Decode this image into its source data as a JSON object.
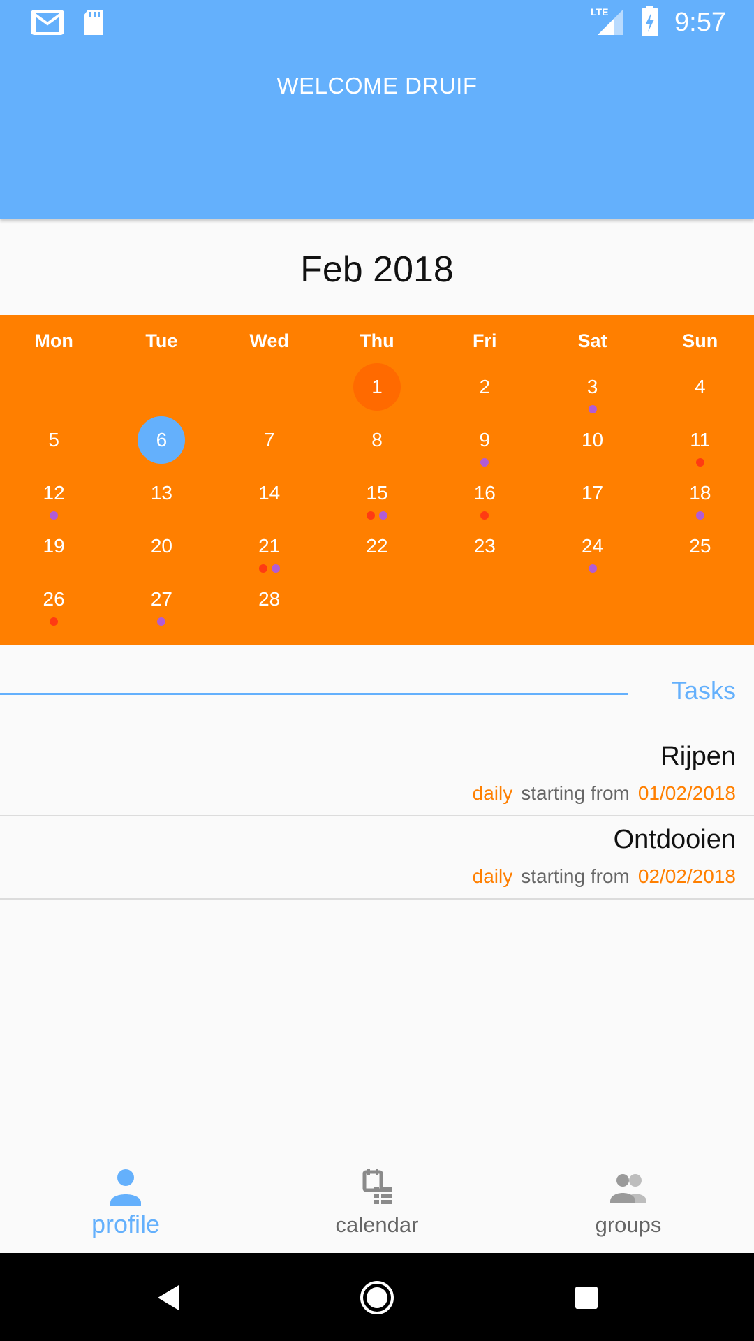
{
  "status_bar": {
    "time": "9:57",
    "network": "LTE"
  },
  "header": {
    "title": "WELCOME DRUIF"
  },
  "calendar": {
    "month_title": "Feb 2018",
    "weekdays": [
      "Mon",
      "Tue",
      "Wed",
      "Thu",
      "Fri",
      "Sat",
      "Sun"
    ],
    "first_weekday_index": 3,
    "days_in_month": 28,
    "start_day": 1,
    "today": 6,
    "event_dots": {
      "3": [
        "purple"
      ],
      "9": [
        "purple"
      ],
      "11": [
        "red"
      ],
      "12": [
        "purple"
      ],
      "15": [
        "red",
        "purple"
      ],
      "16": [
        "red"
      ],
      "18": [
        "purple"
      ],
      "21": [
        "red",
        "purple"
      ],
      "24": [
        "purple"
      ],
      "26": [
        "red"
      ],
      "27": [
        "purple"
      ]
    },
    "colors": {
      "background": "#ff7f00",
      "start_circle": "#ff6a00",
      "today_circle": "#64b0fc",
      "dot_red": "#ff3b12",
      "dot_purple": "#b15cd6"
    }
  },
  "tasks": {
    "label": "Tasks",
    "items": [
      {
        "title": "Rijpen",
        "frequency": "daily",
        "from_text": "starting from",
        "date": "01/02/2018"
      },
      {
        "title": "Ontdooien",
        "frequency": "daily",
        "from_text": "starting from",
        "date": "02/02/2018"
      }
    ]
  },
  "bottom_nav": {
    "items": [
      {
        "label": "profile",
        "icon": "person-icon",
        "active": true
      },
      {
        "label": "calendar",
        "icon": "calendar-list-icon",
        "active": false
      },
      {
        "label": "groups",
        "icon": "group-icon",
        "active": false
      }
    ]
  },
  "theme": {
    "primary": "#64b0fc",
    "accent": "#ff7f00"
  }
}
